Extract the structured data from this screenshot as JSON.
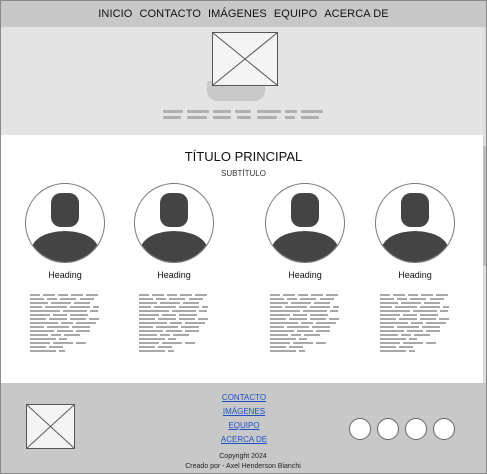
{
  "nav": {
    "items": [
      "INICIO",
      "CONTACTO",
      "IMÁGENES",
      "EQUIPO",
      "ACERCA DE"
    ]
  },
  "main": {
    "title": "TÍTULO PRINCIPAL",
    "subtitle": "SUBTÍTULO",
    "cards": [
      {
        "heading": "Heading"
      },
      {
        "heading": "Heading"
      },
      {
        "heading": "Heading"
      },
      {
        "heading": "Heading"
      }
    ]
  },
  "footer": {
    "links": [
      "CONTACTO",
      "IMÁGENES",
      "EQUIPO",
      "ACERCA DE"
    ],
    "copyright": "Copyright 2024",
    "credit": "Creado por - Axel Henderson Bianchi"
  },
  "icons": {
    "image_placeholder": "image-placeholder-icon",
    "avatar": "user-avatar-icon",
    "social": "social-circle-icon"
  },
  "colors": {
    "nav_bg": "#c8c8c8",
    "hero_bg": "#e4e4e4",
    "footer_bg": "#c8c8c8",
    "avatar_fill": "#444444",
    "link": "#1f4fc6"
  }
}
